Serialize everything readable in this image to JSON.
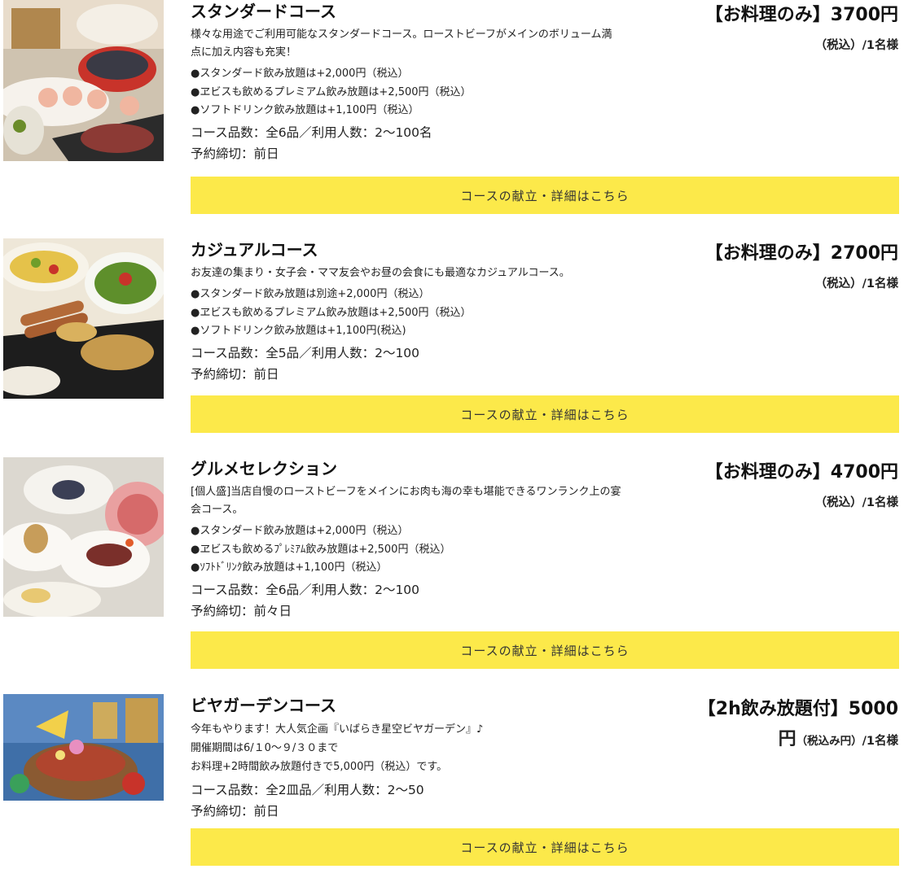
{
  "courses": [
    {
      "title": "スタンダードコース",
      "desc_lines": [
        "様々な用途でご利用可能なスタンダードコース。ローストビーフがメインのボリューム満",
        "点に加え内容も充実！"
      ],
      "options": [
        "●スタンダード飲み放題は+2,000円（税込）",
        "●ヱビスも飲めるプレミアム飲み放題は+2,500円（税込）",
        "●ソフトドリンク飲み放題は+1,100円（税込）"
      ],
      "count": "コース品数：全6品／利用人数：2〜100名",
      "deadline": "予約締切：前日",
      "price_main": "【お料理のみ】3700円",
      "price_sub": "（税込）/1名様",
      "button": "コースの献立・詳細はこちら"
    },
    {
      "title": "カジュアルコース",
      "desc_lines": [
        "お友達の集まり・女子会・ママ友会やお昼の会食にも最適なカジュアルコース。"
      ],
      "options": [
        "●スタンダード飲み放題は別途+2,000円（税込）",
        "●ヱビスも飲めるプレミアム飲み放題は+2,500円（税込）",
        "●ソフトドリンク飲み放題は+1,100円(税込)"
      ],
      "count": "コース品数：全5品／利用人数：2〜100",
      "deadline": "予約締切：前日",
      "price_main": "【お料理のみ】2700円",
      "price_sub": "（税込）/1名様",
      "button": "コースの献立・詳細はこちら"
    },
    {
      "title": "グルメセレクション",
      "desc_lines": [
        "[個人盛]当店自慢のローストビーフをメインにお肉も海の幸も堪能できるワンランク上の宴",
        "会コース。"
      ],
      "options": [
        "●スタンダード飲み放題は+2,000円（税込）",
        "●ヱビスも飲めるﾌﾟﾚﾐｱﾑ飲み放題は+2,500円（税込）",
        "●ｿﾌﾄﾄﾞﾘﾝｸ飲み放題は+1,100円（税込）"
      ],
      "count": "コース品数：全6品／利用人数：2〜100",
      "deadline": "予約締切：前々日",
      "price_main": "【お料理のみ】4700円",
      "price_sub": "（税込）/1名様",
      "button": "コースの献立・詳細はこちら"
    },
    {
      "title": "ビヤガーデンコース",
      "desc_lines": [
        "今年もやります！大人気企画『いばらき星空ビヤガーデン』♪",
        "開催期間は6/１0〜９/３０まで",
        "お料理+2時間飲み放題付きで5,000円（税込）です。"
      ],
      "options": [],
      "count": "コース品数：全2皿品／利用人数：2〜50",
      "deadline": "予約締切：前日",
      "price_main": "【2h飲み放題付】5000",
      "price_sub_yen": "円",
      "price_sub_small": "（税込み円）",
      "price_sub_rest": "/1名様",
      "button": "コースの献立・詳細はこちら"
    }
  ],
  "colors": {
    "button": "#fce94a",
    "text": "#222222"
  }
}
